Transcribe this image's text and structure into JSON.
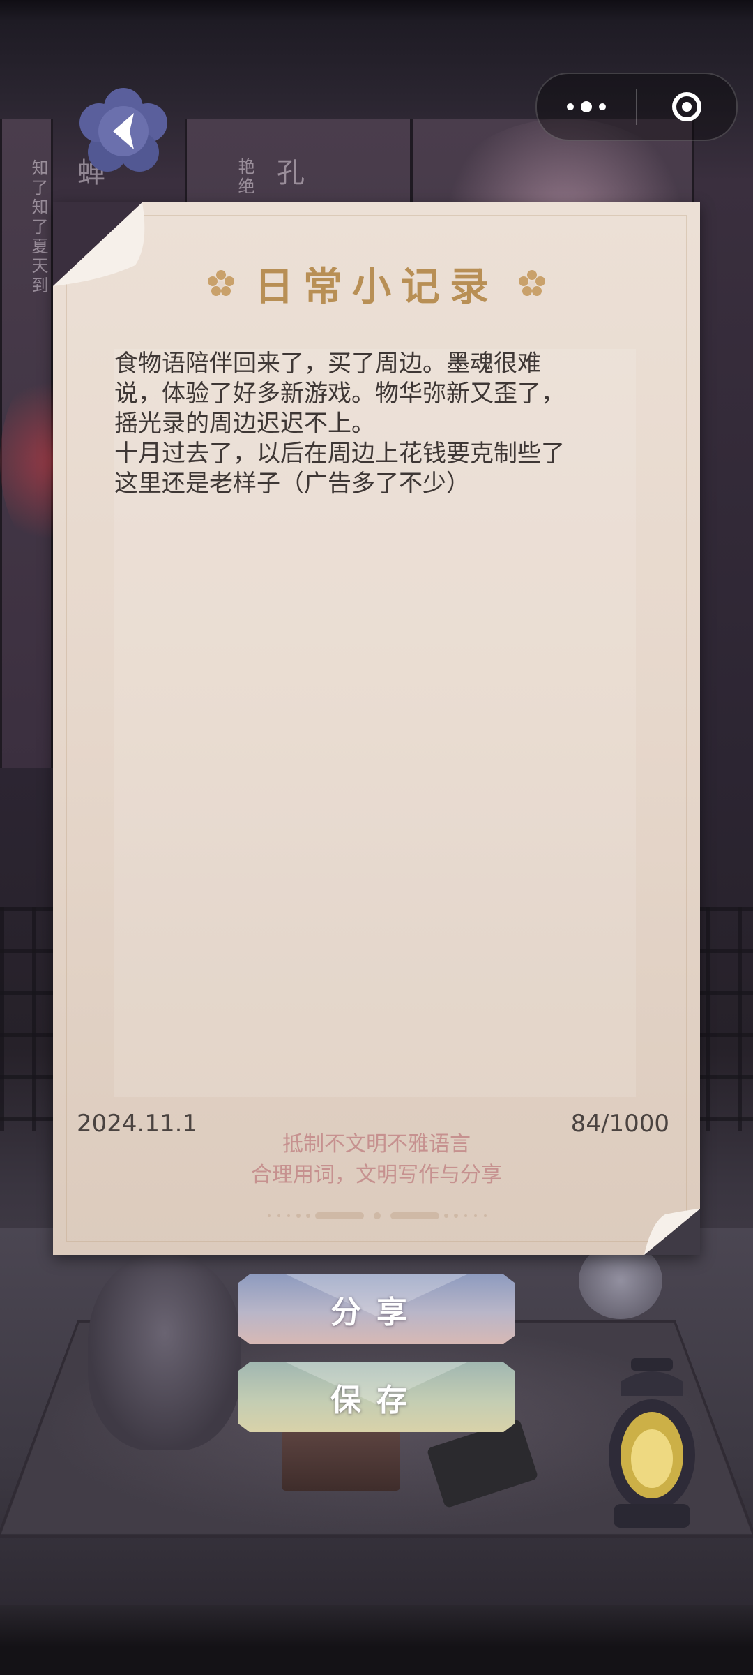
{
  "header": {
    "back_icon": "chevron-left-icon",
    "more_icon": "more-dots-icon",
    "close_icon": "target-circle-icon"
  },
  "background": {
    "vertical_texts": [
      "蝉",
      "知了知了夏天到",
      "艳绝",
      "孔"
    ]
  },
  "card": {
    "title": "日常小记录",
    "entry_text": "食物语陪伴回来了，买了周边。墨魂很难\n说，体验了好多新游戏。物华弥新又歪了，\n摇光录的周边迟迟不上。\n十月过去了，以后在周边上花钱要克制些了\n这里还是老样子（广告多了不少）",
    "date": "2024.11.1",
    "char_count": "84/1000",
    "notice_line1": "抵制不文明不雅语言",
    "notice_line2": "合理用词，文明写作与分享"
  },
  "nav": {
    "prev_icon": "double-chevron-left-icon",
    "next_icon": "double-chevron-right-icon"
  },
  "actions": {
    "share_label": "分享",
    "save_label": "保存"
  },
  "colors": {
    "title_gold": "#b88f55",
    "notice_pink": "#c6918f",
    "paper": "#e6d7cb"
  }
}
